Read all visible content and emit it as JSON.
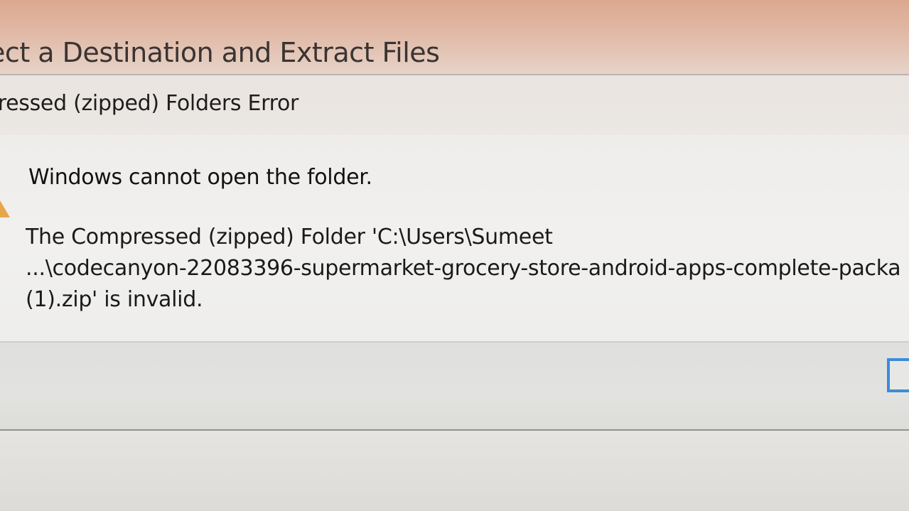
{
  "wizard": {
    "title": "lect a Destination and Extract Files"
  },
  "error_dialog": {
    "title": "pressed (zipped) Folders Error",
    "main_instruction": "Windows cannot open the folder.",
    "message_lines": [
      "The Compressed (zipped) Folder 'C:\\Users\\Sumeet",
      "...\\codecanyon-22083396-supermarket-grocery-store-android-apps-complete-packa",
      "(1).zip' is invalid."
    ],
    "ok_button_label": ""
  },
  "colors": {
    "focus_border": "#3d8bd8",
    "warning_icon": "#e7a64a"
  },
  "icons": {
    "warning": "warning-icon"
  }
}
